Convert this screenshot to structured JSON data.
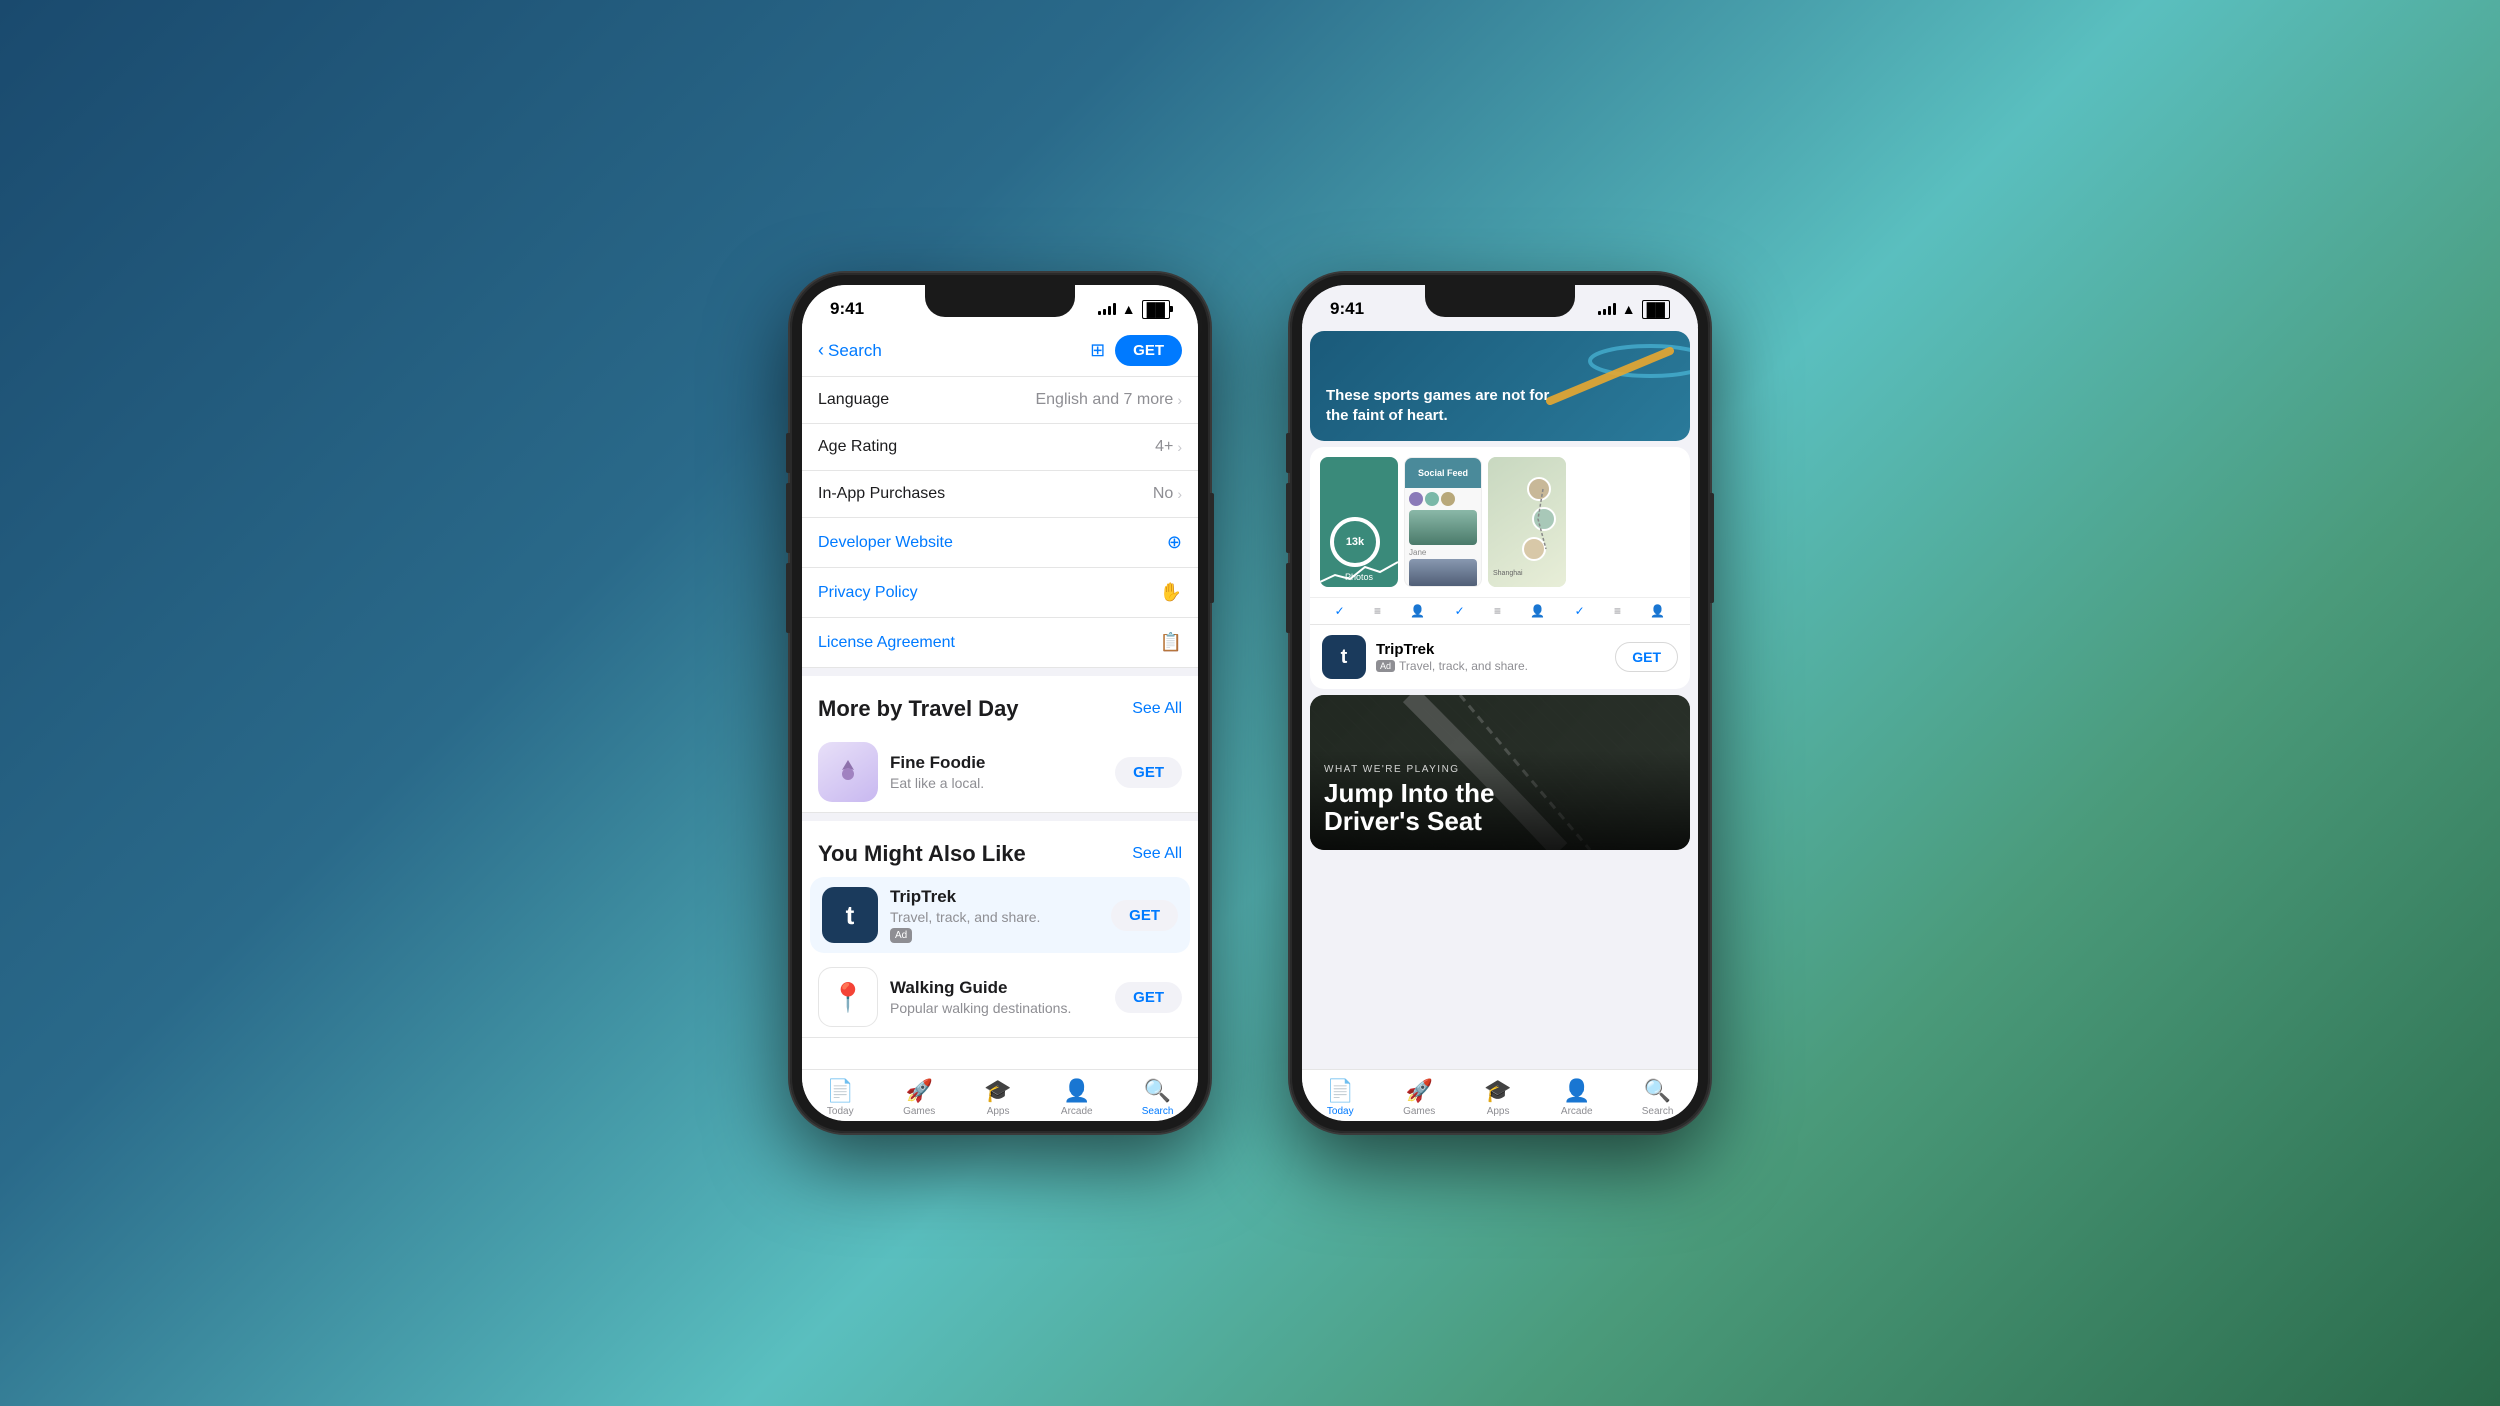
{
  "background": {
    "gradient_start": "#1a4a6e",
    "gradient_end": "#2a6a4a"
  },
  "phone1": {
    "status_bar": {
      "time": "9:41",
      "signal": "●●●●",
      "wifi": "wifi",
      "battery": "battery"
    },
    "nav": {
      "back_label": "Search",
      "filter_icon": "filter-icon",
      "get_label": "GET"
    },
    "info_rows": [
      {
        "label": "Language",
        "value": "English and 7 more",
        "has_chevron": true
      },
      {
        "label": "Age Rating",
        "value": "4+",
        "has_chevron": true
      },
      {
        "label": "In-App Purchases",
        "value": "No",
        "has_chevron": true
      }
    ],
    "links": [
      {
        "label": "Developer Website",
        "icon": "external-link-icon"
      },
      {
        "label": "Privacy Policy",
        "icon": "hand-icon"
      },
      {
        "label": "License Agreement",
        "icon": "document-icon"
      }
    ],
    "more_section": {
      "title": "More by Travel Day",
      "see_all": "See All",
      "apps": [
        {
          "name": "Fine Foodie",
          "subtitle": "Eat like a local.",
          "get_label": "GET",
          "icon_bg": "#c8b8f0"
        }
      ]
    },
    "also_like_section": {
      "title": "You Might Also Like",
      "see_all": "See All",
      "apps": [
        {
          "name": "TripTrek",
          "subtitle": "Travel, track, and share.",
          "get_label": "GET",
          "is_ad": true,
          "ad_label": "Ad",
          "icon_bg": "#1a3a5c"
        },
        {
          "name": "Walking Guide",
          "subtitle": "Popular walking destinations.",
          "get_label": "GET",
          "is_ad": false
        }
      ]
    },
    "tab_bar": {
      "items": [
        {
          "label": "Today",
          "icon": "📄",
          "active": false
        },
        {
          "label": "Games",
          "icon": "🎮",
          "active": false
        },
        {
          "label": "Apps",
          "icon": "🏪",
          "active": false
        },
        {
          "label": "Arcade",
          "icon": "👤",
          "active": false
        },
        {
          "label": "Search",
          "icon": "🔍",
          "active": true
        }
      ]
    }
  },
  "phone2": {
    "status_bar": {
      "time": "9:41"
    },
    "sports_card": {
      "text": "These sports games are not for\nthe faint of heart."
    },
    "triptrek_promo": {
      "name": "TripTrek",
      "ad_label": "Ad",
      "subtitle": "Travel, track, and share.",
      "get_label": "GET"
    },
    "what_playing": {
      "category": "WHAT WE'RE PLAYING",
      "title": "Jump Into the\nDriver's Seat"
    },
    "tab_bar": {
      "items": [
        {
          "label": "Today",
          "icon": "📄",
          "active": true
        },
        {
          "label": "Games",
          "icon": "🎮",
          "active": false
        },
        {
          "label": "Apps",
          "icon": "🏪",
          "active": false
        },
        {
          "label": "Arcade",
          "icon": "👤",
          "active": false
        },
        {
          "label": "Search",
          "icon": "🔍",
          "active": false
        }
      ]
    }
  }
}
